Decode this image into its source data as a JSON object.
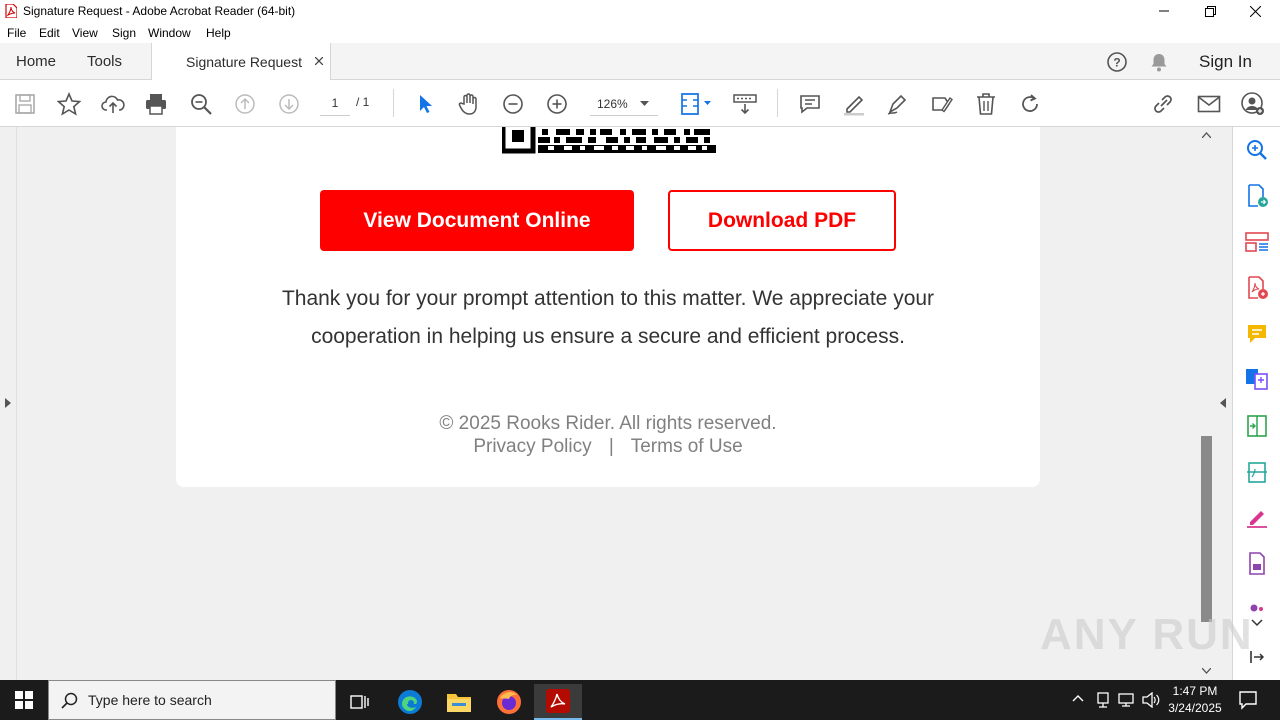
{
  "window": {
    "title": "Signature Request - Adobe Acrobat Reader (64-bit)"
  },
  "menu": [
    "File",
    "Edit",
    "View",
    "Sign",
    "Window",
    "Help"
  ],
  "tabs": {
    "home": "Home",
    "tools": "Tools",
    "document": "Signature Request",
    "sign_in": "Sign In"
  },
  "toolbar": {
    "page_current": "1",
    "page_total": "/ 1",
    "zoom": "126%"
  },
  "document": {
    "view_button": "View Document Online",
    "download_button": "Download PDF",
    "thanks_line1": "Thank you for your prompt attention to this matter. We appreciate your",
    "thanks_line2": "cooperation in helping us ensure a secure and efficient process.",
    "copyright": "© 2025 Rooks Rider. All rights reserved.",
    "privacy": "Privacy Policy",
    "separator": "|",
    "terms": "Terms of Use"
  },
  "taskbar": {
    "search_placeholder": "Type here to search",
    "time": "1:47 PM",
    "date": "3/24/2025"
  },
  "watermark": "ANY RUN",
  "colors": {
    "accent_red": "#ff0000",
    "acrobat_blue": "#1473e6",
    "taskbar": "#1b1b1b"
  }
}
